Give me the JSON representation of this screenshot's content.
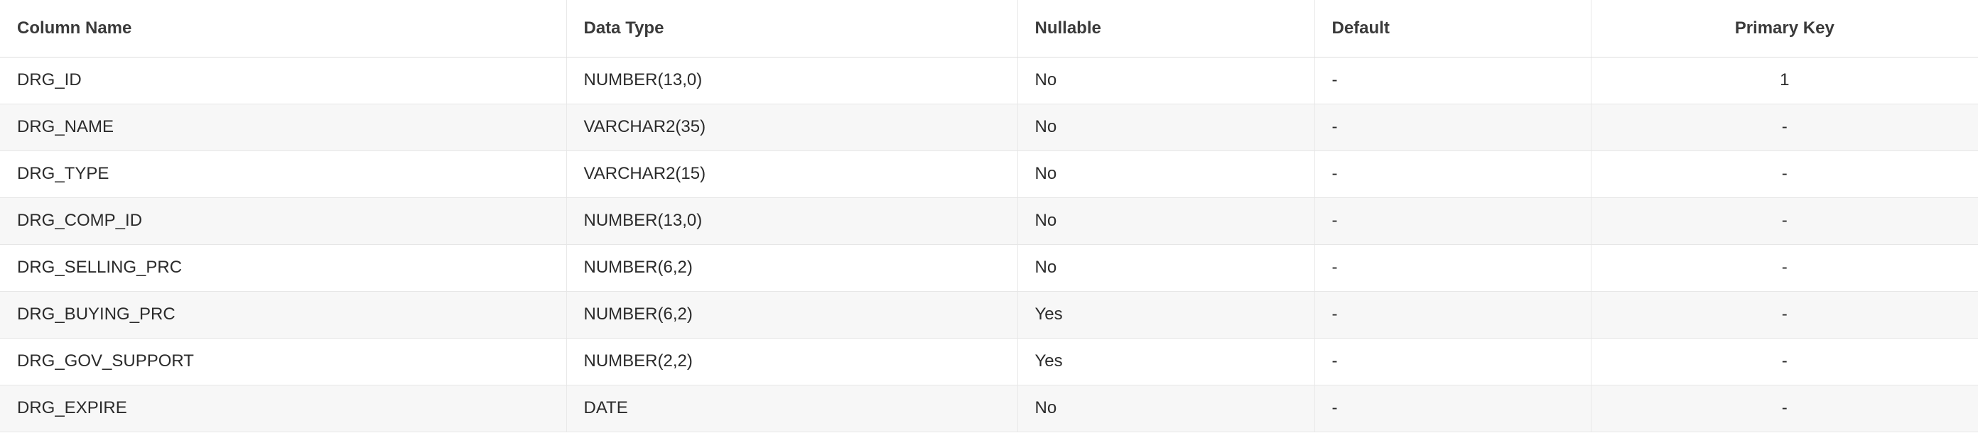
{
  "columns": {
    "column_name": "Column Name",
    "data_type": "Data Type",
    "nullable": "Nullable",
    "default": "Default",
    "primary_key": "Primary Key"
  },
  "rows": [
    {
      "column_name": "DRG_ID",
      "data_type": "NUMBER(13,0)",
      "nullable": "No",
      "default": "-",
      "primary_key": "1"
    },
    {
      "column_name": "DRG_NAME",
      "data_type": "VARCHAR2(35)",
      "nullable": "No",
      "default": "-",
      "primary_key": "-"
    },
    {
      "column_name": "DRG_TYPE",
      "data_type": "VARCHAR2(15)",
      "nullable": "No",
      "default": "-",
      "primary_key": "-"
    },
    {
      "column_name": "DRG_COMP_ID",
      "data_type": "NUMBER(13,0)",
      "nullable": "No",
      "default": "-",
      "primary_key": "-"
    },
    {
      "column_name": "DRG_SELLING_PRC",
      "data_type": "NUMBER(6,2)",
      "nullable": "No",
      "default": "-",
      "primary_key": "-"
    },
    {
      "column_name": "DRG_BUYING_PRC",
      "data_type": "NUMBER(6,2)",
      "nullable": "Yes",
      "default": "-",
      "primary_key": "-"
    },
    {
      "column_name": "DRG_GOV_SUPPORT",
      "data_type": "NUMBER(2,2)",
      "nullable": "Yes",
      "default": "-",
      "primary_key": "-"
    },
    {
      "column_name": "DRG_EXPIRE",
      "data_type": "DATE",
      "nullable": "No",
      "default": "-",
      "primary_key": "-"
    }
  ]
}
